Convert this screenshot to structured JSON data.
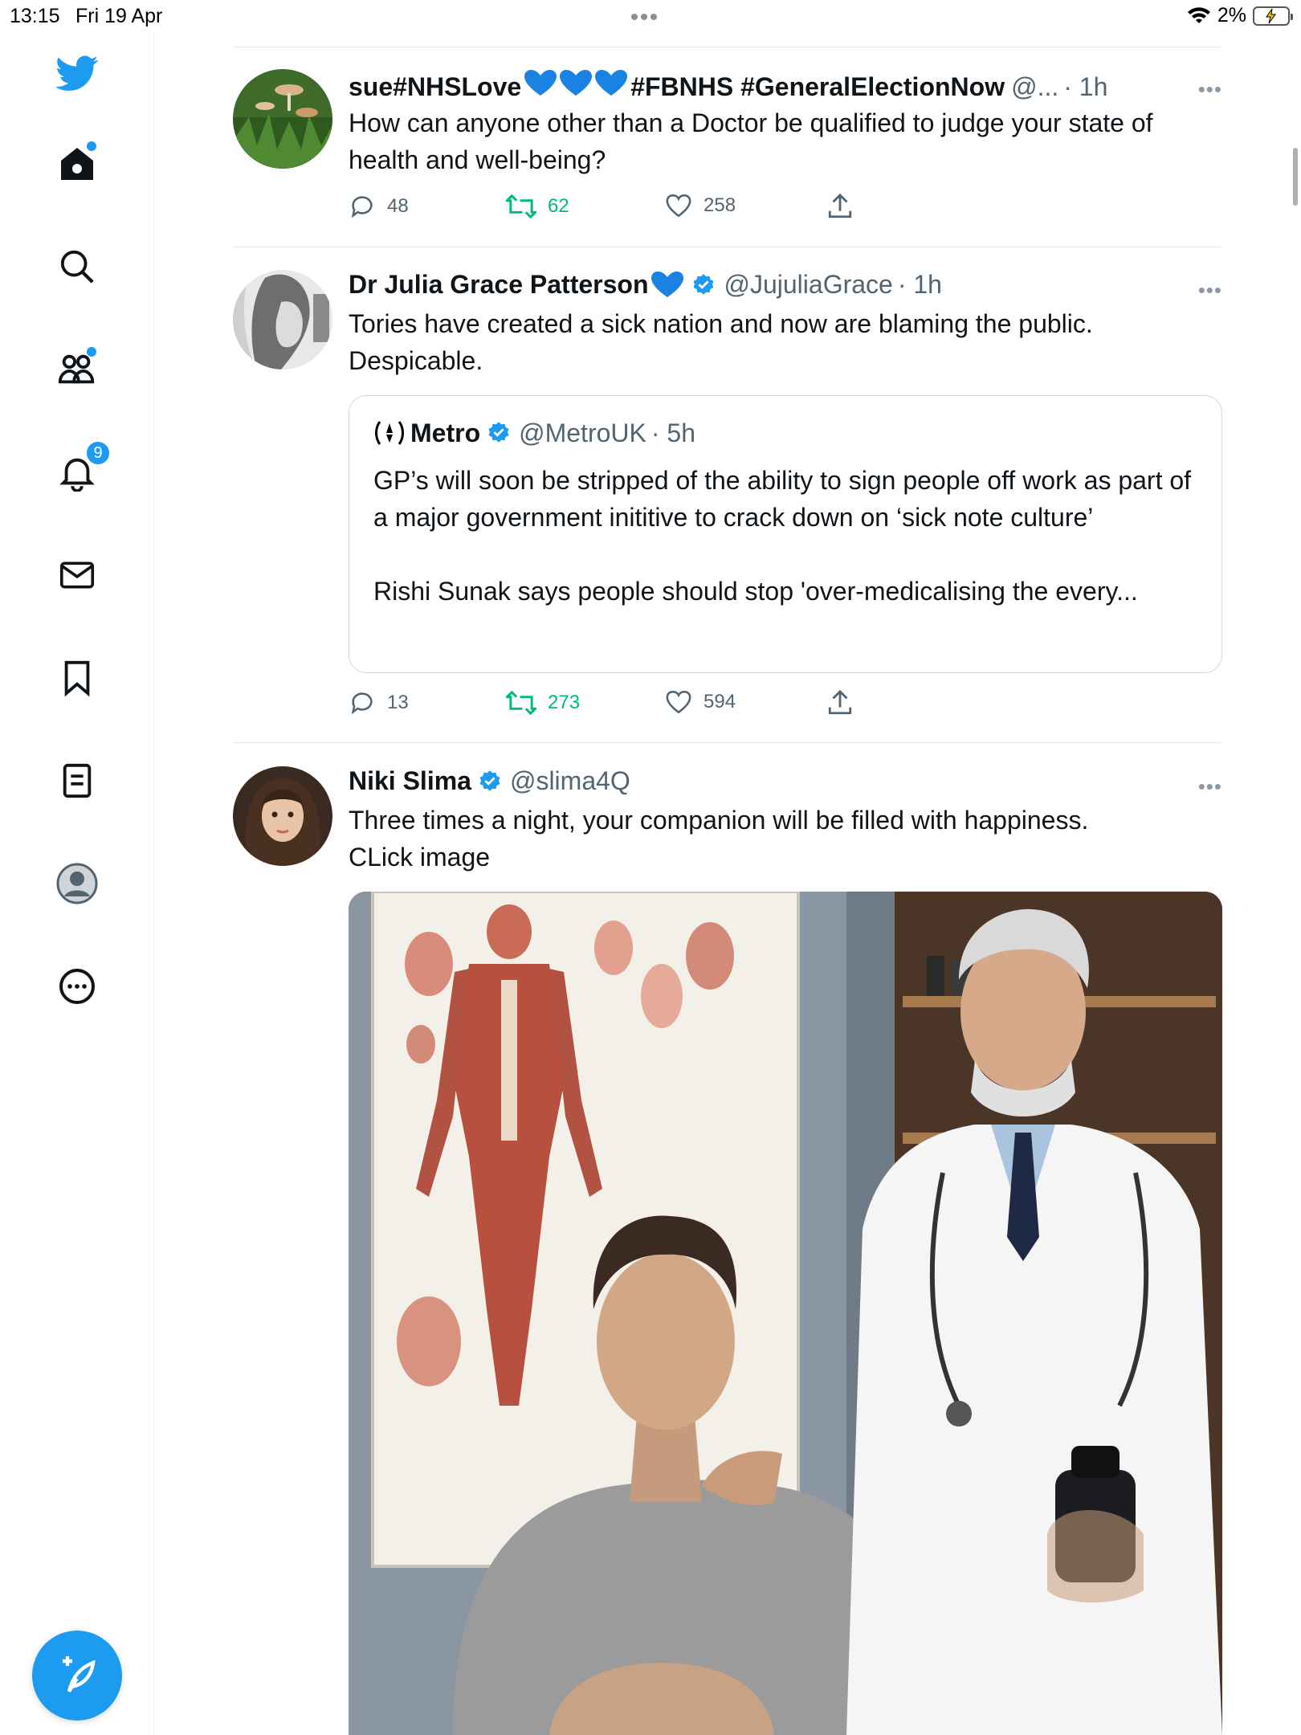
{
  "status_bar": {
    "time": "13:15",
    "date": "Fri 19 Apr",
    "battery": "2%"
  },
  "sidebar": {
    "notifications_count": "9",
    "items": [
      "twitter-logo",
      "home",
      "search",
      "communities",
      "notifications",
      "messages",
      "bookmarks",
      "lists",
      "profile",
      "more"
    ]
  },
  "tweets": [
    {
      "name": "sue#NHSLove",
      "name_suffix": "#FBNHS #GeneralElectionNow",
      "handle": "@...",
      "time": "· 1h",
      "text": "How can anyone other than a Doctor be qualified to judge your state of health and well-being?",
      "replies": "48",
      "retweets": "62",
      "likes": "258"
    },
    {
      "name": "Dr Julia Grace Patterson",
      "handle": "@JujuliaGrace",
      "time": "· 1h",
      "text": "Tories have created a sick nation and now are blaming the public. Despicable.",
      "quote": {
        "name": "Metro",
        "handle": "@MetroUK",
        "time": "· 5h",
        "text_1": "GP’s will soon be stripped of the ability to sign people off work as part of a major government inititive to crack down on ‘sick note culture’",
        "text_2": "Rishi Sunak says people should stop 'over-medicalising the every..."
      },
      "replies": "13",
      "retweets": "273",
      "likes": "594"
    },
    {
      "name": "Niki Slima",
      "handle": "@slima4Q",
      "time": "",
      "text_1": "Three times a night, your companion will be filled with happiness.",
      "text_2": "CLick image"
    }
  ],
  "colors": {
    "accent": "#1d9bf0",
    "retweet": "#00ba7c",
    "muted": "#536471"
  }
}
